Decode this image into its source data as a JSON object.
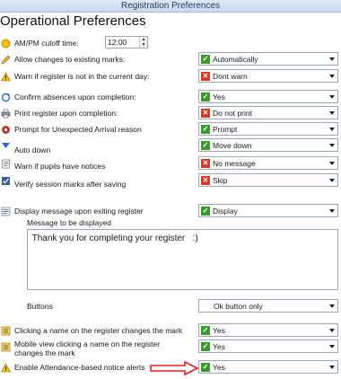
{
  "window": {
    "title": "Registration Preferences"
  },
  "heading": "Operational Preferences",
  "cutoff": {
    "label": "AM/PM cutoff time:",
    "value": "12:00"
  },
  "settings": [
    {
      "label": "Allow changes to existing marks:",
      "value": "Automatically",
      "state": "ok",
      "icon": "pencil-icon"
    },
    {
      "label": "Warn if register is not in the current day:",
      "value": "Dont warn",
      "state": "no",
      "icon": "warning-icon"
    },
    {
      "label": "Confirm absences upon completion:",
      "value": "Yes",
      "state": "ok",
      "icon": "refresh-icon"
    },
    {
      "label": "Print register upon completion:",
      "value": "Do not print",
      "state": "no",
      "icon": "printer-icon"
    },
    {
      "label": "Prompt for Unexpected Arrival reason",
      "value": "Prompt",
      "state": "ok",
      "icon": "gear-icon"
    },
    {
      "label": "Auto down",
      "value": "Move down",
      "state": "ok",
      "icon": "arrow-down-icon"
    },
    {
      "label": "Warn if pupils have notices",
      "value": "No message",
      "state": "no",
      "icon": "notice-icon"
    },
    {
      "label": "Verify session marks after saving",
      "value": "Skip",
      "state": "no",
      "icon": "verify-icon"
    },
    {
      "label": "Display message upon exiting register",
      "value": "Display",
      "state": "ok",
      "icon": "message-icon"
    }
  ],
  "message": {
    "label": "Message to be displayed",
    "text": " Thank you for completing your register   :)"
  },
  "buttons": {
    "label": "Buttons",
    "value": "Ok button only"
  },
  "bottom_settings": [
    {
      "label": "Clicking a name on the register changes the mark",
      "value": "Yes",
      "state": "ok",
      "icon": "register-icon"
    },
    {
      "label": "Mobile view clicking a name on the register",
      "label2": "changes the mark",
      "value": "Yes",
      "state": "ok",
      "icon": "register-icon"
    },
    {
      "label": "Enable Attendance-based notice alerts",
      "value": "Yes",
      "state": "ok",
      "icon": "warning-icon"
    }
  ],
  "annotation": {
    "arrow_color": "#e02020"
  },
  "colors": {
    "ok": "#3b9a2e",
    "no": "#d23a2a",
    "title": "#1e395b"
  }
}
